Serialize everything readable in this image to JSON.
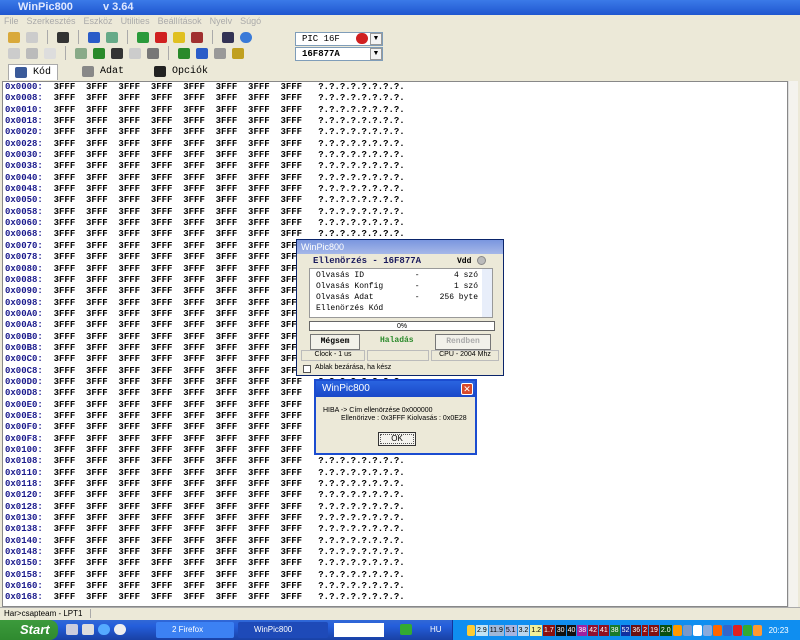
{
  "window": {
    "title": "WinPic800",
    "version": "v 3.64"
  },
  "menu": [
    "File",
    "Szerkesztés",
    "Eszköz",
    "Utilities",
    "Beállítások",
    "Nyelv",
    "Súgó"
  ],
  "device": {
    "family": "PIC 16F",
    "model": "16F877A"
  },
  "tabs": [
    {
      "label": "Kód",
      "icon": "code-icon"
    },
    {
      "label": "Adat",
      "icon": "data-icon"
    },
    {
      "label": "Opciók",
      "icon": "options-icon"
    }
  ],
  "hex_rows": [
    {
      "addr": "0x0000:"
    },
    {
      "addr": "0x0008:"
    },
    {
      "addr": "0x0010:"
    },
    {
      "addr": "0x0018:"
    },
    {
      "addr": "0x0020:"
    },
    {
      "addr": "0x0028:"
    },
    {
      "addr": "0x0030:"
    },
    {
      "addr": "0x0038:"
    },
    {
      "addr": "0x0040:"
    },
    {
      "addr": "0x0048:"
    },
    {
      "addr": "0x0050:"
    },
    {
      "addr": "0x0058:"
    },
    {
      "addr": "0x0060:"
    },
    {
      "addr": "0x0068:"
    },
    {
      "addr": "0x0070:"
    },
    {
      "addr": "0x0078:"
    },
    {
      "addr": "0x0080:"
    },
    {
      "addr": "0x0088:"
    },
    {
      "addr": "0x0090:"
    },
    {
      "addr": "0x0098:"
    },
    {
      "addr": "0x00A0:"
    },
    {
      "addr": "0x00A8:"
    },
    {
      "addr": "0x00B0:"
    },
    {
      "addr": "0x00B8:"
    },
    {
      "addr": "0x00C0:"
    },
    {
      "addr": "0x00C8:"
    },
    {
      "addr": "0x00D0:"
    },
    {
      "addr": "0x00D8:"
    },
    {
      "addr": "0x00E0:"
    },
    {
      "addr": "0x00E8:"
    },
    {
      "addr": "0x00F0:"
    },
    {
      "addr": "0x00F8:"
    },
    {
      "addr": "0x0100:"
    },
    {
      "addr": "0x0108:"
    },
    {
      "addr": "0x0110:"
    },
    {
      "addr": "0x0118:"
    },
    {
      "addr": "0x0120:"
    },
    {
      "addr": "0x0128:"
    },
    {
      "addr": "0x0130:"
    },
    {
      "addr": "0x0138:"
    },
    {
      "addr": "0x0140:"
    },
    {
      "addr": "0x0148:"
    },
    {
      "addr": "0x0150:"
    },
    {
      "addr": "0x0158:"
    },
    {
      "addr": "0x0160:"
    },
    {
      "addr": "0x0168:"
    }
  ],
  "hex_words": "3FFF  3FFF  3FFF  3FFF  3FFF  3FFF  3FFF  3FFF",
  "hex_ascii": "?.?.?.?.?.?.?.?.",
  "progress_dialog": {
    "title": "WinPic800",
    "heading": "Ellenörzés - 16F877A",
    "vdd": "Vdd",
    "log": [
      [
        "Olvasás ID",
        "-",
        "4 szó"
      ],
      [
        "Olvasás Konfig",
        "-",
        "1 szó"
      ],
      [
        "Olvasás Adat",
        "-",
        "256 byte"
      ],
      [
        "Ellenörzés Kód",
        "",
        ""
      ]
    ],
    "progress_percent": 0,
    "progress_label": "0%",
    "cancel": "Mégsem",
    "progress_text": "Haladás",
    "ok": "Rendben",
    "clock": "Clock - 1 us",
    "cpu": "CPU - 2004 Mhz",
    "close_when_done": "Ablak bezárása, ha kész",
    "close_checked": false
  },
  "error_dialog": {
    "title": "WinPic800",
    "line1": "HIBA  -> Cím ellenörzése 0x000000",
    "line2": "Ellenörizve : 0x3FFF   Kiolvasás : 0x0E28",
    "ok": "OK"
  },
  "status": "Har>csapteam - LPT1",
  "taskbar": {
    "start": "Start",
    "tasks": [
      "2 Firefox",
      "WinPic800"
    ],
    "lang": "HU",
    "clock": "20:23",
    "tray_values": [
      {
        "v": "2.9",
        "c": "#bfe3f5",
        "f": "#000"
      },
      {
        "v": "11.9",
        "c": "#9fb8d8",
        "f": "#000"
      },
      {
        "v": "5.1",
        "c": "#a7b4e0",
        "f": "#000"
      },
      {
        "v": "3.2",
        "c": "#b9d6ee",
        "f": "#000"
      },
      {
        "v": "1.2",
        "c": "#f0f09a",
        "f": "#000"
      },
      {
        "v": "1.7",
        "c": "#8a1010",
        "f": "#fff"
      },
      {
        "v": "30",
        "c": "#111",
        "f": "#fff"
      },
      {
        "v": "40",
        "c": "#111",
        "f": "#fff"
      },
      {
        "v": "38",
        "c": "#a020a0",
        "f": "#fff"
      },
      {
        "v": "42",
        "c": "#901030",
        "f": "#fff"
      },
      {
        "v": "41",
        "c": "#901020",
        "f": "#fff"
      },
      {
        "v": "38",
        "c": "#1a7a2a",
        "f": "#fff"
      },
      {
        "v": "52",
        "c": "#1030a0",
        "f": "#fff"
      },
      {
        "v": "36",
        "c": "#6a1010",
        "f": "#fff"
      },
      {
        "v": "2",
        "c": "#901010",
        "f": "#fff"
      },
      {
        "v": "19",
        "c": "#801010",
        "f": "#fff"
      },
      {
        "v": "2.0",
        "c": "#0a5010",
        "f": "#fff"
      }
    ]
  }
}
